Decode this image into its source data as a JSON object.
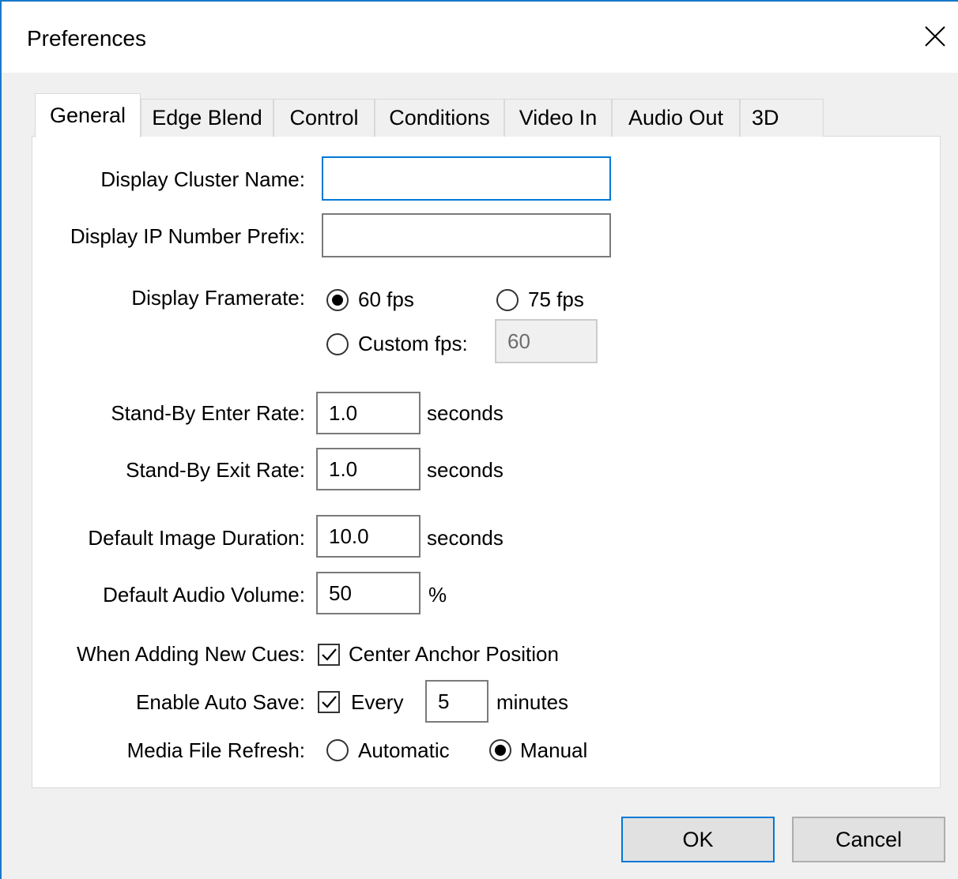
{
  "window": {
    "title": "Preferences"
  },
  "tabs": [
    {
      "label": "General",
      "active": true
    },
    {
      "label": "Edge Blend"
    },
    {
      "label": "Control"
    },
    {
      "label": "Conditions"
    },
    {
      "label": "Video In"
    },
    {
      "label": "Audio Out"
    },
    {
      "label": "3D"
    }
  ],
  "general": {
    "cluster_name_label": "Display Cluster Name:",
    "cluster_name_value": "",
    "ip_prefix_label": "Display IP Number Prefix:",
    "ip_prefix_value": "",
    "framerate_label": "Display Framerate:",
    "fps60_label": "60 fps",
    "fps75_label": "75 fps",
    "custom_fps_label": "Custom fps:",
    "custom_fps_value": "60",
    "framerate_selected": "60 fps",
    "standby_enter_label": "Stand-By Enter Rate:",
    "standby_enter_value": "1.0",
    "standby_exit_label": "Stand-By Exit Rate:",
    "standby_exit_value": "1.0",
    "image_duration_label": "Default Image Duration:",
    "image_duration_value": "10.0",
    "audio_volume_label": "Default Audio Volume:",
    "audio_volume_value": "50",
    "seconds_unit": "seconds",
    "percent_unit": "%",
    "new_cues_label": "When Adding New Cues:",
    "center_anchor_label": "Center Anchor Position",
    "center_anchor_checked": true,
    "auto_save_label": "Enable Auto Save:",
    "auto_save_every_label": "Every",
    "auto_save_checked": true,
    "auto_save_minutes_value": "5",
    "minutes_unit": "minutes",
    "media_refresh_label": "Media File Refresh:",
    "automatic_label": "Automatic",
    "manual_label": "Manual",
    "media_refresh_selected": "Manual"
  },
  "buttons": {
    "ok": "OK",
    "cancel": "Cancel"
  },
  "colors": {
    "accent": "#0078d7",
    "title_border": "#1979ca"
  }
}
